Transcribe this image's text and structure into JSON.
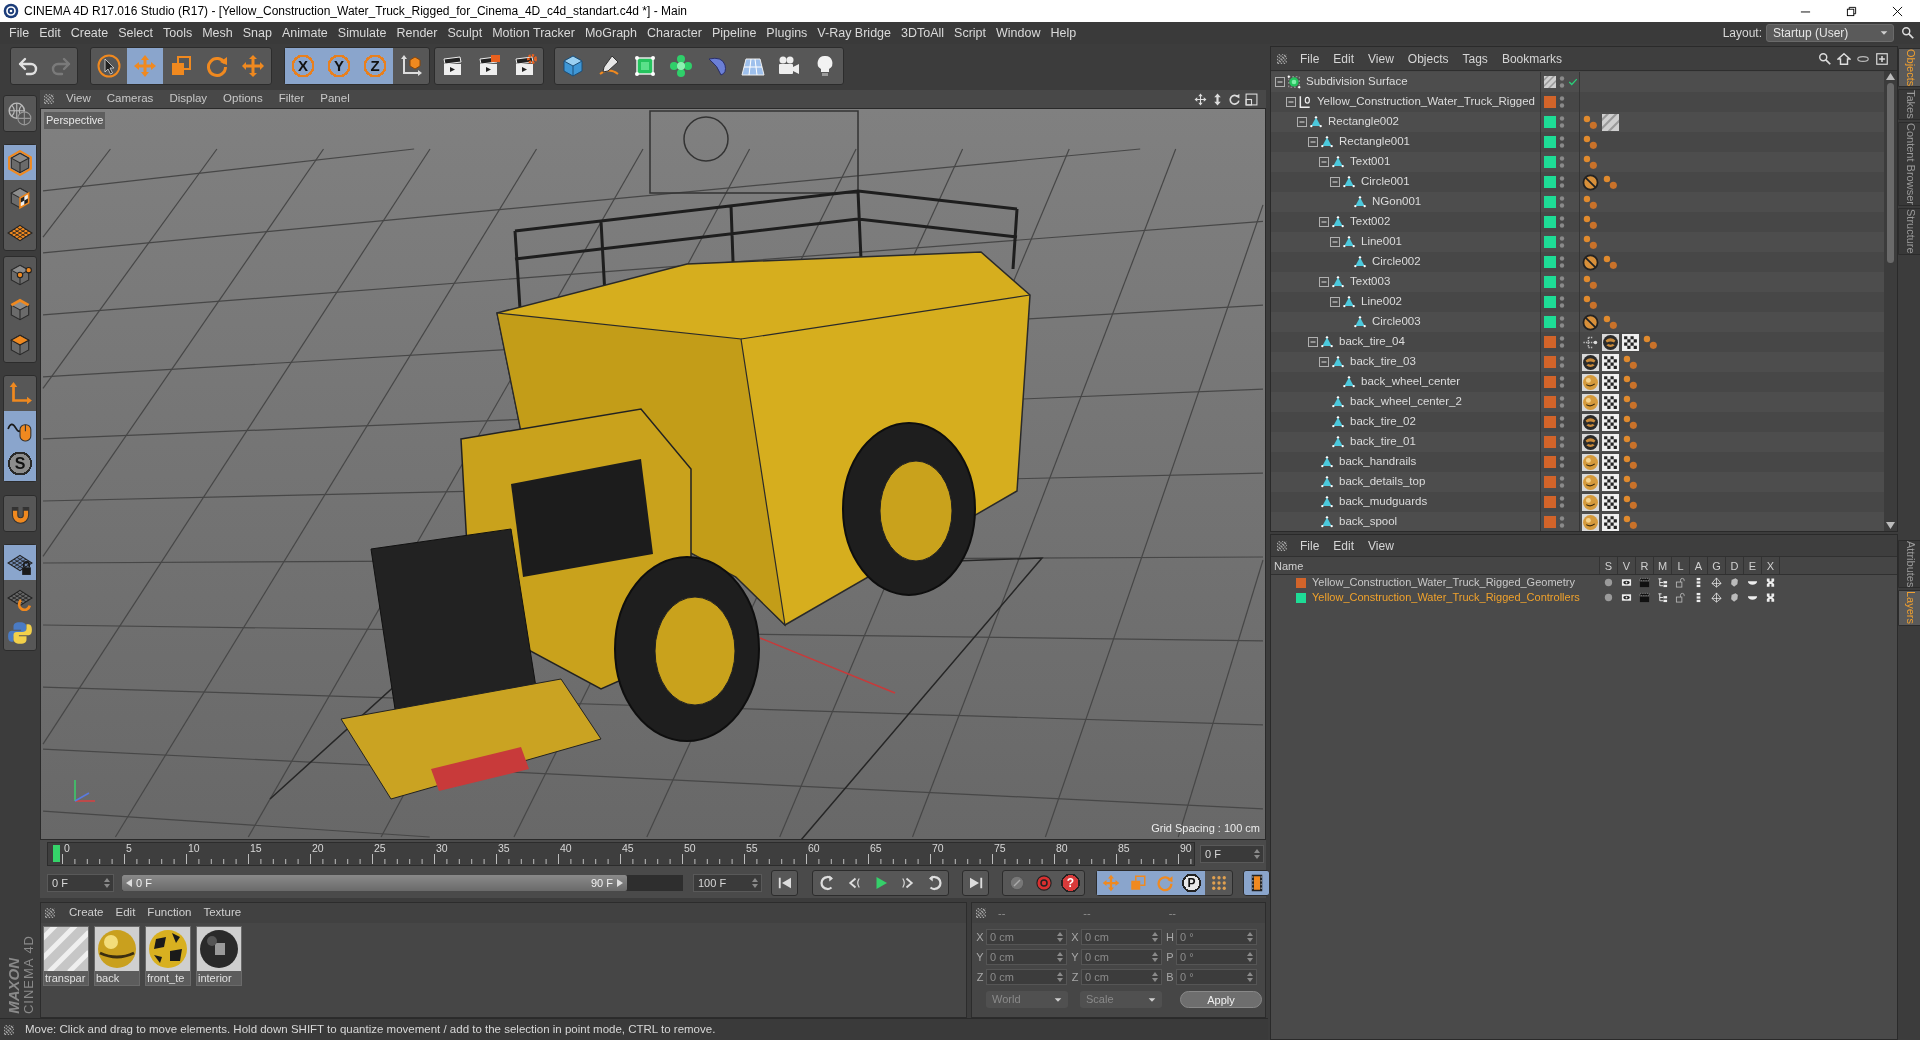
{
  "window": {
    "title": "CINEMA 4D R17.016 Studio (R17) - [Yellow_Construction_Water_Truck_Rigged_for_Cinema_4D_c4d_standart.c4d *] - Main"
  },
  "menu": [
    "File",
    "Edit",
    "Create",
    "Select",
    "Tools",
    "Mesh",
    "Snap",
    "Animate",
    "Simulate",
    "Render",
    "Sculpt",
    "Motion Tracker",
    "MoGraph",
    "Character",
    "Pipeline",
    "Plugins",
    "V-Ray Bridge",
    "3DToAll",
    "Script",
    "Window",
    "Help"
  ],
  "layout": {
    "label": "Layout:",
    "value": "Startup (User)"
  },
  "toolbar": [
    {
      "tools": [
        {
          "kind": "undo",
          "selected": false,
          "disabled": false
        },
        {
          "kind": "redo",
          "selected": false,
          "disabled": true
        }
      ]
    },
    {
      "tools": [
        {
          "kind": "select",
          "selected": false,
          "disabled": false
        },
        {
          "kind": "move",
          "selected": true,
          "disabled": false
        },
        {
          "kind": "scale",
          "selected": false,
          "disabled": false
        },
        {
          "kind": "rotate",
          "selected": false,
          "disabled": false
        },
        {
          "kind": "transform",
          "selected": false,
          "disabled": false
        }
      ]
    },
    {
      "tools": [
        {
          "kind": "axis",
          "label": "X",
          "selected": true,
          "disabled": false
        },
        {
          "kind": "axis",
          "label": "Y",
          "selected": true,
          "disabled": false
        },
        {
          "kind": "axis",
          "label": "Z",
          "selected": true,
          "disabled": false
        },
        {
          "kind": "coords",
          "selected": false,
          "disabled": false
        }
      ]
    },
    {
      "tools": [
        {
          "kind": "renderview",
          "selected": false,
          "disabled": false
        },
        {
          "kind": "render",
          "selected": false,
          "disabled": false
        },
        {
          "kind": "rendersettings",
          "selected": false,
          "disabled": false
        }
      ]
    },
    {
      "tools": [
        {
          "kind": "cube",
          "selected": false,
          "disabled": false
        },
        {
          "kind": "pen",
          "selected": false,
          "disabled": false
        },
        {
          "kind": "subdivision",
          "selected": false,
          "disabled": false
        },
        {
          "kind": "cloner",
          "selected": false,
          "disabled": false
        },
        {
          "kind": "deformer",
          "selected": false,
          "disabled": false
        },
        {
          "kind": "floor",
          "selected": false,
          "disabled": false
        },
        {
          "kind": "camera",
          "selected": false,
          "disabled": false
        },
        {
          "kind": "light",
          "selected": false,
          "disabled": false
        }
      ]
    }
  ],
  "tools_left": [
    {
      "tools": [
        {
          "kind": "editable",
          "selected": false
        }
      ]
    },
    {
      "tools": [
        {
          "kind": "model",
          "selected": true
        },
        {
          "kind": "texture",
          "selected": false
        },
        {
          "kind": "workplane",
          "selected": false
        }
      ]
    },
    {
      "tools": [
        {
          "kind": "points",
          "selected": false
        },
        {
          "kind": "edges",
          "selected": false
        },
        {
          "kind": "polygons",
          "selected": false
        }
      ]
    },
    {
      "tools": [
        {
          "kind": "axismode",
          "selected": false
        },
        {
          "kind": "tweak",
          "selected": true
        },
        {
          "kind": "snap",
          "label": "S",
          "selected": true
        }
      ]
    },
    {
      "tools": [
        {
          "kind": "magnet",
          "selected": false
        }
      ]
    },
    {
      "tools": [
        {
          "kind": "lockgrid",
          "selected": true
        },
        {
          "kind": "gridrotate",
          "selected": false
        },
        {
          "kind": "python",
          "selected": false
        }
      ]
    }
  ],
  "viewport": {
    "menu": [
      "View",
      "Cameras",
      "Display",
      "Options",
      "Filter",
      "Panel"
    ],
    "camera": "Perspective",
    "grid_spacing": "Grid Spacing : 100 cm"
  },
  "timeline": {
    "ticks": [
      "0",
      "5",
      "10",
      "15",
      "20",
      "25",
      "30",
      "35",
      "40",
      "45",
      "50",
      "55",
      "60",
      "65",
      "70",
      "75",
      "80",
      "85",
      "90"
    ],
    "current_frame": "0 F",
    "start_frame": "0 F",
    "range": {
      "start": "0 F",
      "end": "90 F",
      "level": 0.9
    },
    "end_frame": "100 F",
    "transport": [
      {
        "buttons": [
          {
            "kind": "first"
          }
        ]
      },
      {
        "buttons": [
          {
            "kind": "prevkey"
          },
          {
            "kind": "prevframe"
          },
          {
            "kind": "play"
          },
          {
            "kind": "nextframe"
          },
          {
            "kind": "nextkey"
          }
        ]
      },
      {
        "buttons": [
          {
            "kind": "last"
          }
        ]
      },
      {
        "buttons": [
          {
            "kind": "motion"
          },
          {
            "kind": "record"
          },
          {
            "kind": "autokey",
            "label": "?"
          }
        ]
      },
      {
        "buttons": [
          {
            "kind": "keypos",
            "selected": true
          },
          {
            "kind": "keyscale",
            "selected": true
          },
          {
            "kind": "keyrot",
            "selected": true
          },
          {
            "kind": "keyparam",
            "label": "P",
            "selected": true
          },
          {
            "kind": "keygrid",
            "selected": false
          }
        ]
      },
      {
        "buttons": [
          {
            "kind": "film",
            "selected": true
          }
        ]
      }
    ]
  },
  "materials": {
    "menu": [
      "Create",
      "Edit",
      "Function",
      "Texture"
    ],
    "items": [
      {
        "name": "transpar",
        "kind": "stripes"
      },
      {
        "name": "back",
        "kind": "glossy"
      },
      {
        "name": "front_te",
        "kind": "spotted"
      },
      {
        "name": "interior",
        "kind": "matte"
      }
    ]
  },
  "coordinates": {
    "headers": [
      "--",
      "--",
      "--"
    ],
    "disabled": true,
    "columns": [
      {
        "fields": [
          {
            "axis": "X",
            "value": "0 cm"
          },
          {
            "axis": "Y",
            "value": "0 cm"
          },
          {
            "axis": "Z",
            "value": "0 cm"
          }
        ]
      },
      {
        "fields": [
          {
            "axis": "X",
            "value": "0 cm"
          },
          {
            "axis": "Y",
            "value": "0 cm"
          },
          {
            "axis": "Z",
            "value": "0 cm"
          }
        ]
      },
      {
        "fields": [
          {
            "axis": "H",
            "value": "0 °"
          },
          {
            "axis": "P",
            "value": "0 °"
          },
          {
            "axis": "B",
            "value": "0 °"
          }
        ]
      }
    ],
    "dropdowns": [
      "World",
      "Scale"
    ],
    "apply": "Apply"
  },
  "status_bar": {
    "text": "Move: Click and drag to move elements. Hold down SHIFT to quantize movement / add to the selection in point mode, CTRL to remove."
  },
  "brand_logo": {
    "brand": "MAXON",
    "product": "CINEMA 4D"
  },
  "objects": {
    "menu": [
      "File",
      "Edit",
      "View",
      "Objects",
      "Tags",
      "Bookmarks"
    ],
    "tree": [
      {
        "name": "Subdivision Surface",
        "kind": "generator",
        "expanded": true,
        "children": [
          {
            "name": "Yellow_Construction_Water_Truck_Rigged",
            "kind": "null",
            "color": "#d2642a",
            "expanded": true,
            "children": [
              {
                "name": "Rectangle002",
                "kind": "polygon",
                "color": "#1edc96",
                "tags": [
                  {
                    "kind": "dots"
                  },
                  {
                    "kind": "stripes"
                  }
                ],
                "expanded": true,
                "children": [
                  {
                    "name": "Rectangle001",
                    "kind": "polygon",
                    "color": "#1edc96",
                    "tags": [
                      {
                        "kind": "dots"
                      }
                    ],
                    "expanded": true,
                    "children": [
                      {
                        "name": "Text001",
                        "kind": "polygon",
                        "color": "#1edc96",
                        "tags": [
                          {
                            "kind": "dots"
                          }
                        ],
                        "expanded": true,
                        "children": [
                          {
                            "name": "Circle001",
                            "kind": "polygon",
                            "color": "#1edc96",
                            "tags": [
                              {
                                "kind": "stop"
                              },
                              {
                                "kind": "dots"
                              }
                            ],
                            "expanded": true,
                            "children": [
                              {
                                "name": "NGon001",
                                "kind": "polygon",
                                "color": "#1edc96",
                                "tags": [
                                  {
                                    "kind": "dots"
                                  }
                                ]
                              }
                            ]
                          }
                        ]
                      },
                      {
                        "name": "Text002",
                        "kind": "polygon",
                        "color": "#1edc96",
                        "tags": [
                          {
                            "kind": "dots"
                          }
                        ],
                        "expanded": true,
                        "children": [
                          {
                            "name": "Line001",
                            "kind": "polygon",
                            "color": "#1edc96",
                            "tags": [
                              {
                                "kind": "dots"
                              }
                            ],
                            "expanded": true,
                            "children": [
                              {
                                "name": "Circle002",
                                "kind": "polygon",
                                "color": "#1edc96",
                                "tags": [
                                  {
                                    "kind": "stop"
                                  },
                                  {
                                    "kind": "dots"
                                  }
                                ]
                              }
                            ]
                          }
                        ]
                      },
                      {
                        "name": "Text003",
                        "kind": "polygon",
                        "color": "#1edc96",
                        "tags": [
                          {
                            "kind": "dots"
                          }
                        ],
                        "expanded": true,
                        "children": [
                          {
                            "name": "Line002",
                            "kind": "polygon",
                            "color": "#1edc96",
                            "tags": [
                              {
                                "kind": "dots"
                              }
                            ],
                            "expanded": true,
                            "children": [
                              {
                                "name": "Circle003",
                                "kind": "polygon",
                                "color": "#1edc96",
                                "tags": [
                                  {
                                    "kind": "stop"
                                  },
                                  {
                                    "kind": "dots"
                                  }
                                ]
                              }
                            ]
                          }
                        ]
                      }
                    ]
                  },
                  {
                    "name": "back_tire_04",
                    "kind": "polygon",
                    "color": "#d2642a",
                    "tags": [
                      {
                        "kind": "branch"
                      },
                      {
                        "kind": "tire"
                      },
                      {
                        "kind": "checker"
                      },
                      {
                        "kind": "dots"
                      }
                    ],
                    "expanded": true,
                    "children": [
                      {
                        "name": "back_tire_03",
                        "kind": "polygon",
                        "color": "#d2642a",
                        "tags": [
                          {
                            "kind": "tire"
                          },
                          {
                            "kind": "checker"
                          },
                          {
                            "kind": "dots"
                          }
                        ],
                        "expanded": true,
                        "children": [
                          {
                            "name": "back_wheel_center",
                            "kind": "polygon",
                            "color": "#d2642a",
                            "tags": [
                              {
                                "kind": "ball"
                              },
                              {
                                "kind": "checker"
                              },
                              {
                                "kind": "dots"
                              }
                            ]
                          }
                        ]
                      },
                      {
                        "name": "back_wheel_center_2",
                        "kind": "polygon",
                        "color": "#d2642a",
                        "tags": [
                          {
                            "kind": "ball"
                          },
                          {
                            "kind": "checker"
                          },
                          {
                            "kind": "dots"
                          }
                        ]
                      },
                      {
                        "name": "back_tire_02",
                        "kind": "polygon",
                        "color": "#d2642a",
                        "tags": [
                          {
                            "kind": "tire"
                          },
                          {
                            "kind": "checker"
                          },
                          {
                            "kind": "dots"
                          }
                        ]
                      },
                      {
                        "name": "back_tire_01",
                        "kind": "polygon",
                        "color": "#d2642a",
                        "tags": [
                          {
                            "kind": "tire"
                          },
                          {
                            "kind": "checker"
                          },
                          {
                            "kind": "dots"
                          }
                        ]
                      }
                    ]
                  },
                  {
                    "name": "back_handrails",
                    "kind": "polygon",
                    "color": "#d2642a",
                    "tags": [
                      {
                        "kind": "ball"
                      },
                      {
                        "kind": "checker"
                      },
                      {
                        "kind": "dots"
                      }
                    ]
                  },
                  {
                    "name": "back_details_top",
                    "kind": "polygon",
                    "color": "#d2642a",
                    "tags": [
                      {
                        "kind": "ball"
                      },
                      {
                        "kind": "checker"
                      },
                      {
                        "kind": "dots"
                      }
                    ]
                  },
                  {
                    "name": "back_mudguards",
                    "kind": "polygon",
                    "color": "#d2642a",
                    "tags": [
                      {
                        "kind": "ball"
                      },
                      {
                        "kind": "checker"
                      },
                      {
                        "kind": "dots"
                      }
                    ]
                  },
                  {
                    "name": "back_spool",
                    "kind": "polygon",
                    "color": "#d2642a",
                    "tags": [
                      {
                        "kind": "ball"
                      },
                      {
                        "kind": "checker"
                      },
                      {
                        "kind": "dots"
                      }
                    ]
                  }
                ]
              }
            ]
          }
        ]
      }
    ]
  },
  "layers": {
    "menu": [
      "File",
      "Edit",
      "View"
    ],
    "columns": [
      "Name",
      "S",
      "V",
      "R",
      "M",
      "L",
      "A",
      "G",
      "D",
      "E",
      "X"
    ],
    "rows": [
      {
        "name": "Yellow_Construction_Water_Truck_Rigged_Geometry",
        "color": "#d2642a",
        "selected": false
      },
      {
        "name": "Yellow_Construction_Water_Truck_Rigged_Controllers",
        "color": "#1edc96",
        "selected": true
      }
    ]
  },
  "side_tabs": {
    "top": [
      {
        "label": "Objects",
        "selected": true
      },
      {
        "label": "Takes",
        "selected": false
      },
      {
        "label": "Content Browser",
        "selected": false
      },
      {
        "label": "Structure",
        "selected": false
      }
    ],
    "bottom": [
      {
        "label": "Attributes",
        "selected": false
      },
      {
        "label": "Layers",
        "selected": true
      }
    ]
  }
}
